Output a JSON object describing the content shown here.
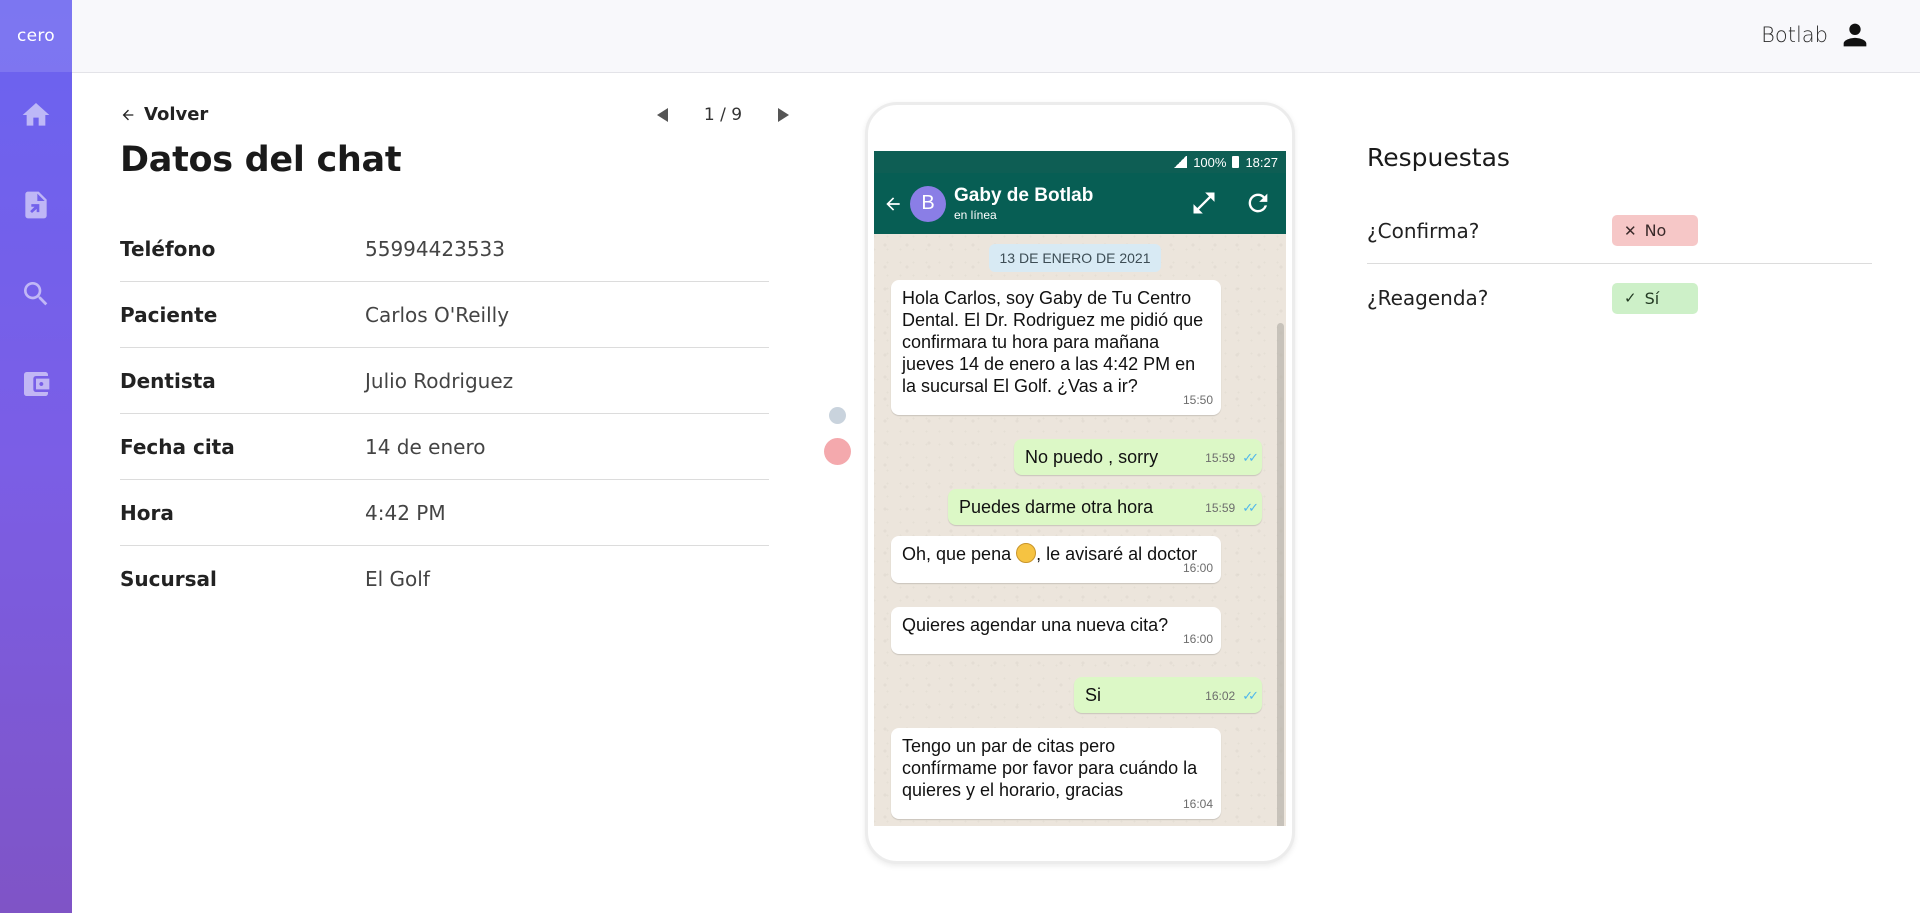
{
  "app": {
    "logo": "cero"
  },
  "sidebar": {
    "items": [
      {
        "name": "home",
        "icon": "home-icon"
      },
      {
        "name": "reports",
        "icon": "document-icon"
      },
      {
        "name": "search",
        "icon": "search-icon"
      },
      {
        "name": "wallet",
        "icon": "wallet-icon"
      }
    ],
    "colors": {
      "top": "#6a63f0",
      "bottom": "#7f54c6"
    }
  },
  "header": {
    "user_name": "Botlab",
    "user_icon": "account-icon"
  },
  "main": {
    "back_label": "Volver",
    "pager": "1 / 9",
    "title": "Datos del chat",
    "fields": [
      {
        "label": "Teléfono",
        "value": "55994423533"
      },
      {
        "label": "Paciente",
        "value": "Carlos O'Reilly"
      },
      {
        "label": "Dentista",
        "value": "Julio Rodriguez"
      },
      {
        "label": "Fecha cita",
        "value": "14 de enero"
      },
      {
        "label": "Hora",
        "value": "4:42 PM"
      },
      {
        "label": "Sucursal",
        "value": "El Golf"
      }
    ]
  },
  "phone": {
    "status": {
      "battery": "100%",
      "time": "18:27"
    },
    "contact": {
      "initial": "B",
      "name": "Gaby de Botlab",
      "status": "en línea"
    },
    "date_chip": "13 DE ENERO DE 2021",
    "messages": [
      {
        "dir": "in",
        "text": "Hola Carlos, soy Gaby de Tu Centro Dental. El Dr. Rodriguez me pidió que confirmara tu hora para mañana jueves 14 de enero a las 4:42 PM en la sucursal El Golf. ¿Vas a ir?",
        "time": "15:50"
      },
      {
        "dir": "out",
        "text": "No puedo , sorry",
        "time": "15:59"
      },
      {
        "dir": "out",
        "text": "Puedes darme otra hora",
        "time": "15:59"
      },
      {
        "dir": "in",
        "text_before": "Oh, que pena ",
        "text_after": ", le avisaré al doctor",
        "emoji": "disappointed-face",
        "time": "16:00"
      },
      {
        "dir": "in",
        "text": "Quieres agendar una nueva cita?",
        "time": "16:00"
      },
      {
        "dir": "out",
        "text": "Si",
        "time": "16:02"
      },
      {
        "dir": "in",
        "text": "Tengo un par de citas pero confírmame por favor para cuándo la quieres y el horario, gracias",
        "time": "16:04"
      }
    ],
    "colors": {
      "header": "#075e54",
      "outgoing": "#dcf8c6",
      "incoming": "#ffffff"
    }
  },
  "responses": {
    "title": "Respuestas",
    "items": [
      {
        "question": "¿Confirma?",
        "answer": "No",
        "icon": "close-icon",
        "color": "#f6c7c7"
      },
      {
        "question": "¿Reagenda?",
        "answer": "Sí",
        "icon": "check-icon",
        "color": "#cdf0c8"
      }
    ]
  }
}
